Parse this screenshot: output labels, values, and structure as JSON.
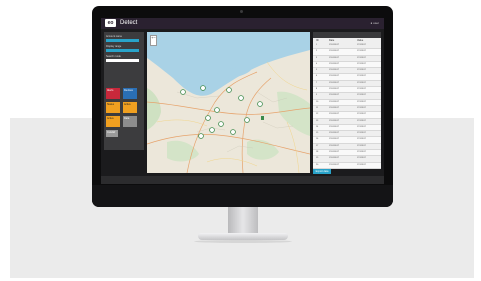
{
  "app": {
    "logo": "eo",
    "title": "Detect",
    "user": "● user"
  },
  "sidebar": {
    "labels": [
      "Account name",
      "Display range",
      "Search mode"
    ],
    "tiles": [
      "Alerts",
      "Devices",
      "Status",
      "Active",
      "Active",
      "Data"
    ],
    "button": "CLEAR"
  },
  "map": {
    "zoom": "+−"
  },
  "table": {
    "headers": [
      "ID",
      "Date",
      "Value"
    ],
    "rows": [
      [
        "1",
        "17/01/2017",
        "17/1/2017"
      ],
      [
        "2",
        "17/01/2017",
        "17/1/2017"
      ],
      [
        "3",
        "17/01/2017",
        "17/1/2017"
      ],
      [
        "4",
        "17/01/2017",
        "17/1/2017"
      ],
      [
        "5",
        "17/01/2017",
        "17/1/2017"
      ],
      [
        "6",
        "17/01/2017",
        "17/1/2017"
      ],
      [
        "7",
        "17/01/2017",
        "17/1/2017"
      ],
      [
        "8",
        "17/01/2017",
        "17/1/2017"
      ],
      [
        "9",
        "17/01/2017",
        "17/1/2017"
      ],
      [
        "10",
        "17/01/2017",
        "17/1/2017"
      ],
      [
        "11",
        "17/01/2017",
        "17/1/2017"
      ],
      [
        "12",
        "17/01/2017",
        "17/1/2017"
      ],
      [
        "13",
        "17/01/2017",
        "17/1/2017"
      ],
      [
        "14",
        "17/01/2017",
        "17/1/2017"
      ],
      [
        "15",
        "17/01/2017",
        "17/1/2017"
      ],
      [
        "16",
        "17/01/2017",
        "17/1/2017"
      ],
      [
        "17",
        "17/01/2017",
        "17/1/2017"
      ],
      [
        "18",
        "17/01/2017",
        "17/1/2017"
      ],
      [
        "19",
        "17/01/2017",
        "17/1/2017"
      ],
      [
        "20",
        "17/01/2017",
        "17/1/2017"
      ]
    ],
    "export": "Export data"
  }
}
